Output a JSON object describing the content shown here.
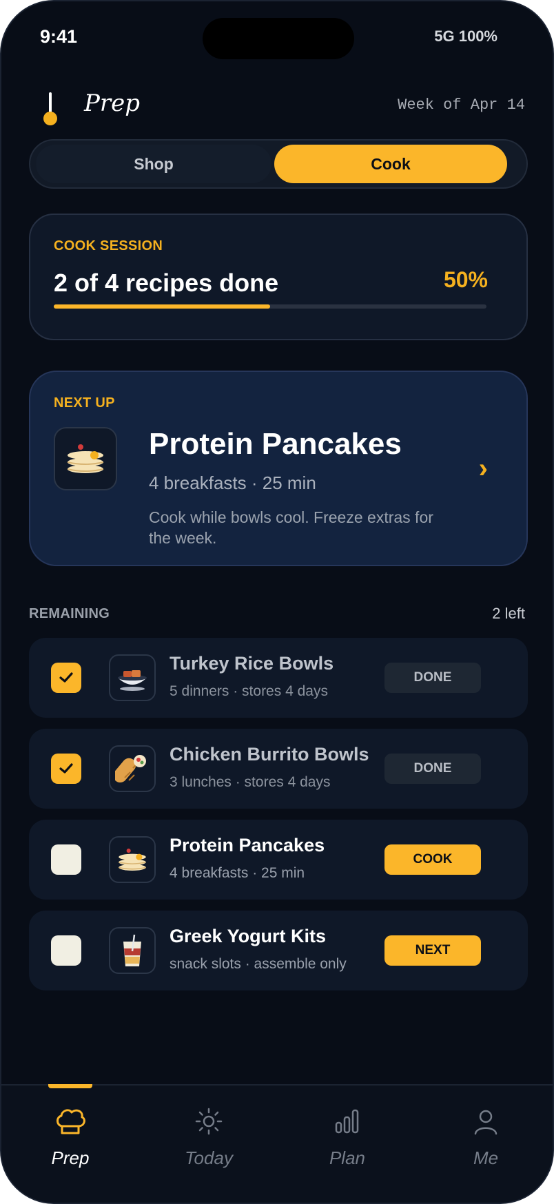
{
  "status_bar": {
    "time": "9:41",
    "indicators": "5G 100%"
  },
  "header": {
    "app_title": "Prep",
    "week_label": "Week of Apr 14",
    "logo_icon": "spoon-logo-icon"
  },
  "segmented": {
    "options": [
      "Shop",
      "Cook"
    ],
    "selected": "Cook"
  },
  "session": {
    "eyebrow": "COOK SESSION",
    "status": "2 of 4 recipes done",
    "percent_label": "50%",
    "progress": 0.5
  },
  "next_up": {
    "eyebrow": "NEXT UP",
    "title": "Protein Pancakes",
    "meta": "4 breakfasts · 25 min",
    "note": "Cook while bowls cool. Freeze extras for the week.",
    "chevron": "›",
    "icon": "pancakes-icon"
  },
  "remaining": {
    "label": "REMAINING",
    "count": "2 left",
    "items": [
      {
        "title": "Turkey Rice Bowls",
        "subtitle": "5 dinners · stores 4 days",
        "checked": true,
        "action": "DONE",
        "icon": "rice-bowl-icon"
      },
      {
        "title": "Chicken Burrito Bowls",
        "subtitle": "3 lunches · stores 4 days",
        "checked": true,
        "action": "DONE",
        "icon": "burrito-icon"
      },
      {
        "title": "Protein Pancakes",
        "subtitle": "4 breakfasts · 25 min",
        "checked": false,
        "action": "COOK",
        "icon": "pancakes-icon"
      },
      {
        "title": "Greek Yogurt Kits",
        "subtitle": "snack slots · assemble only",
        "checked": false,
        "action": "NEXT",
        "icon": "yogurt-cup-icon"
      }
    ]
  },
  "tabbar": {
    "tabs": [
      {
        "label": "Prep",
        "icon": "chef-hat-icon",
        "active": true
      },
      {
        "label": "Today",
        "icon": "sun-icon",
        "active": false
      },
      {
        "label": "Plan",
        "icon": "bar-chart-icon",
        "active": false
      },
      {
        "label": "Me",
        "icon": "person-icon",
        "active": false
      }
    ]
  },
  "colors": {
    "accent": "#fbb62a",
    "background": "#080d17",
    "card": "#0f1828",
    "next_up_card": "#13233f"
  }
}
